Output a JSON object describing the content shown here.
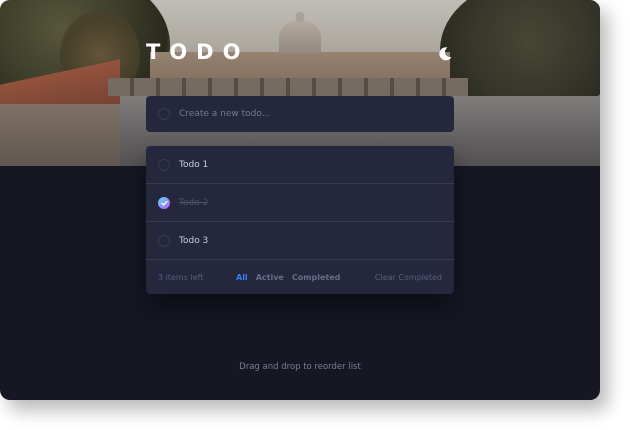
{
  "header": {
    "title": "TODO",
    "theme_icon": "moon-icon"
  },
  "new_todo": {
    "placeholder": "Create a new todo..."
  },
  "todos": [
    {
      "label": "Todo 1",
      "completed": false
    },
    {
      "label": "Todo 2",
      "completed": true
    },
    {
      "label": "Todo 3",
      "completed": false
    }
  ],
  "footer": {
    "items_left": "3 items left",
    "filters": [
      "All",
      "Active",
      "Completed"
    ],
    "active_filter": "All",
    "clear_label": "Clear Completed"
  },
  "hint": "Drag and drop to reorder list",
  "colors": {
    "background": "#171724",
    "card": "#25273d",
    "accent": "#3a7cfd",
    "check_gradient_start": "#55ddff",
    "check_gradient_end": "#c058f3"
  }
}
